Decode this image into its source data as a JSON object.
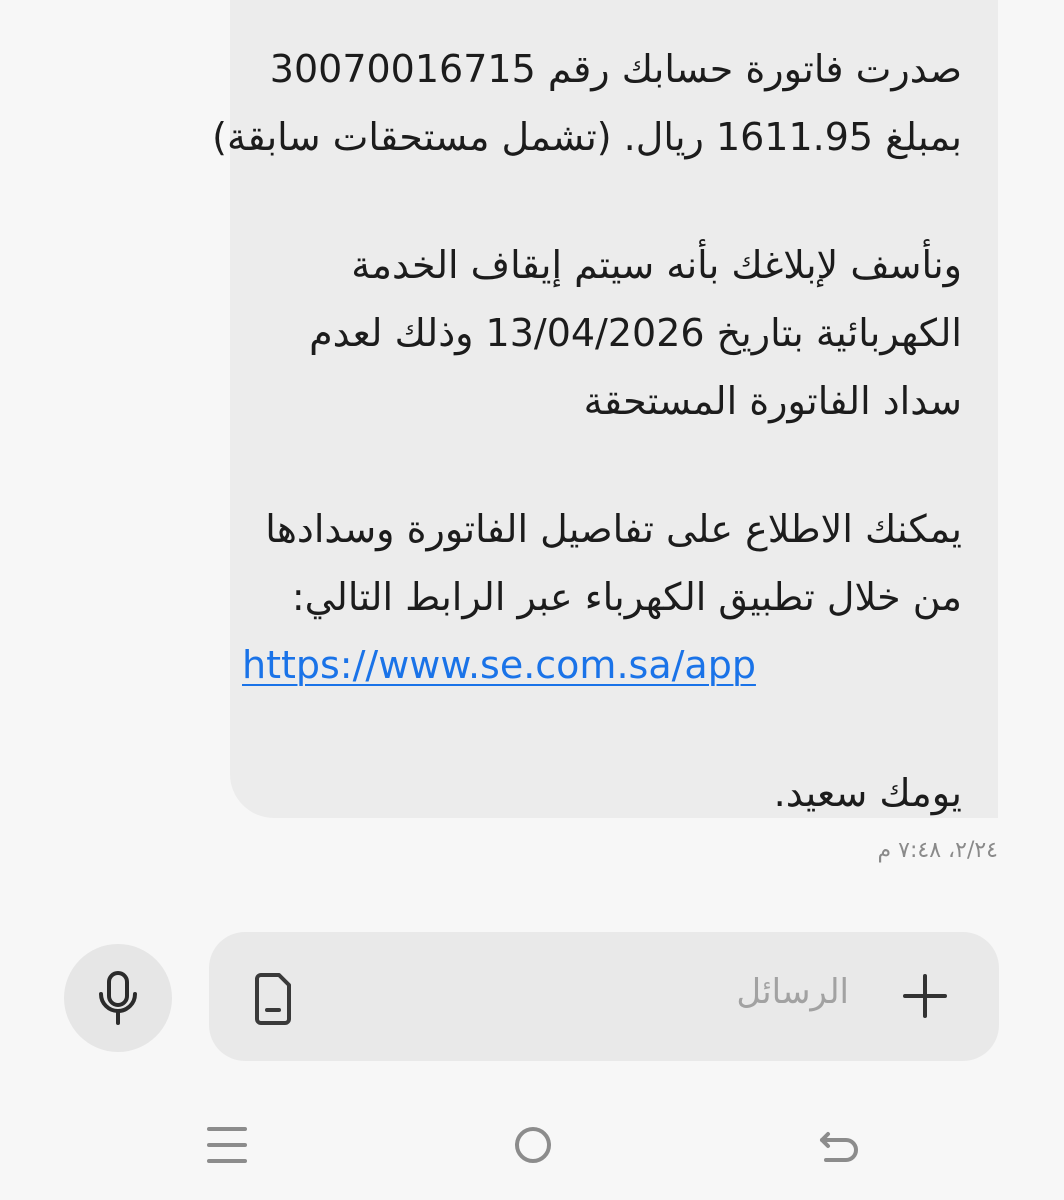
{
  "message": {
    "lines_top": [
      "صدرت فاتورة حسابك رقم 30070016715",
      "بمبلغ 1611.95 ريال. (تشمل مستحقات سابقة)"
    ],
    "lines_mid": [
      "ونأسف لإبلاغك بأنه سيتم إيقاف الخدمة",
      "الكهربائية بتاريخ 13/04/2026 وذلك لعدم",
      "سداد الفاتورة المستحقة"
    ],
    "lines_link_intro": [
      "يمكنك الاطلاع على تفاصيل الفاتورة وسدادها",
      "من خلال تطبيق الكهرباء عبر الرابط التالي:"
    ],
    "link": "https://www.se.com.sa/app",
    "closing": "يومك سعيد."
  },
  "timestamp": "٢/٢٤، ٧:٤٨ م",
  "composer": {
    "placeholder": "الرسائل",
    "mic_icon": "microphone-icon",
    "attach_icon": "sim-card-icon",
    "plus_icon": "plus-icon"
  },
  "navbar": {
    "left_icon": "menu-icon",
    "center_icon": "home-circle-icon",
    "right_icon": "back-icon"
  },
  "colors": {
    "background": "#f7f7f7",
    "bubble": "#ececec",
    "link": "#1a73e8",
    "input": "#e9e9e9"
  }
}
